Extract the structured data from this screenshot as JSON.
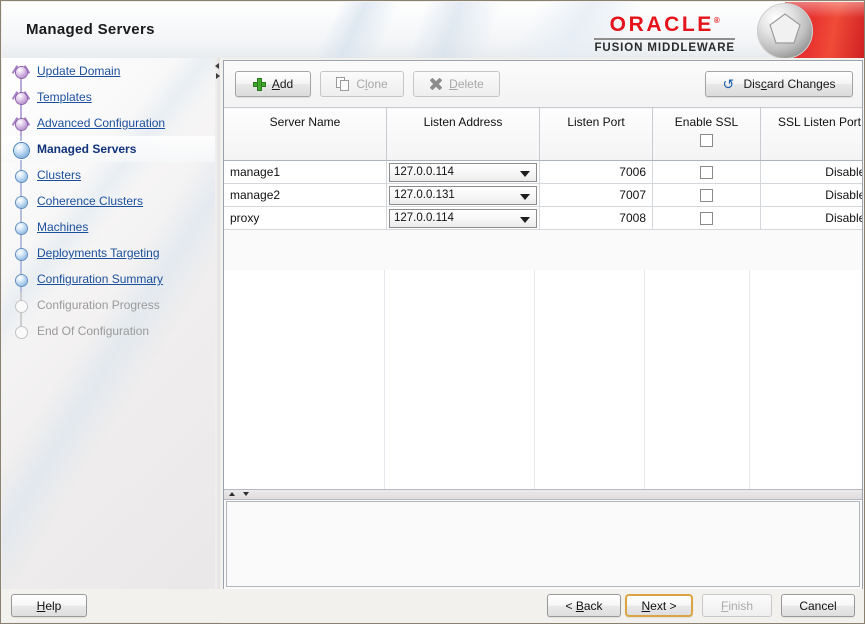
{
  "window": {
    "title": "Managed Servers"
  },
  "brand": {
    "wordmark": "ORACLE",
    "registered": "®",
    "product": "FUSION MIDDLEWARE",
    "logo_icon": "oracle-sphere-icon",
    "accent_red": "#e4141a",
    "link_blue": "#1b4f9c"
  },
  "sidebar": {
    "items": [
      {
        "label": "Update Domain",
        "icon": "branch-node-icon",
        "state": "link"
      },
      {
        "label": "Templates",
        "icon": "branch-node-icon",
        "state": "link"
      },
      {
        "label": "Advanced Configuration",
        "icon": "branch-node-icon",
        "state": "link"
      },
      {
        "label": "Managed Servers",
        "icon": "current-node-icon",
        "state": "current"
      },
      {
        "label": "Clusters",
        "icon": "node-icon",
        "state": "link"
      },
      {
        "label": "Coherence Clusters",
        "icon": "node-icon",
        "state": "link"
      },
      {
        "label": "Machines",
        "icon": "node-icon",
        "state": "link"
      },
      {
        "label": "Deployments Targeting",
        "icon": "node-icon",
        "state": "link"
      },
      {
        "label": "Configuration Summary",
        "icon": "node-icon",
        "state": "link"
      },
      {
        "label": "Configuration Progress",
        "icon": "empty-node-icon",
        "state": "disabled"
      },
      {
        "label": "End Of Configuration",
        "icon": "empty-node-icon",
        "state": "disabled"
      }
    ]
  },
  "toolbar": {
    "add": {
      "label": "Add",
      "mnemonic": "A",
      "icon": "plus-icon",
      "enabled": true
    },
    "clone": {
      "label": "Clone",
      "mnemonic": "l",
      "icon": "copy-icon",
      "enabled": false
    },
    "delete": {
      "label": "Delete",
      "mnemonic": "D",
      "icon": "x-icon",
      "enabled": false
    },
    "discard": {
      "label": "Discard Changes",
      "mnemonic": "c",
      "icon": "undo-icon",
      "enabled": true
    }
  },
  "table": {
    "columns": [
      "Server Name",
      "Listen Address",
      "Listen Port",
      "Enable SSL",
      "SSL Listen Port"
    ],
    "header_ssl_checkbox": false,
    "rows": [
      {
        "server_name": "manage1",
        "listen_address": "127.0.0.114",
        "listen_port": "7006",
        "enable_ssl": false,
        "ssl_listen_port": "Disabled"
      },
      {
        "server_name": "manage2",
        "listen_address": "127.0.0.131",
        "listen_port": "7007",
        "enable_ssl": false,
        "ssl_listen_port": "Disabled"
      },
      {
        "server_name": "proxy",
        "listen_address": "127.0.0.114",
        "listen_port": "7008",
        "enable_ssl": false,
        "ssl_listen_port": "Disabled"
      }
    ]
  },
  "footer": {
    "help": {
      "label": "Help",
      "mnemonic": "H",
      "enabled": true
    },
    "back": {
      "label": "< Back",
      "mnemonic": "B",
      "enabled": true
    },
    "next": {
      "label": "Next >",
      "mnemonic": "N",
      "enabled": true,
      "focused": true
    },
    "finish": {
      "label": "Finish",
      "mnemonic": "F",
      "enabled": false
    },
    "cancel": {
      "label": "Cancel",
      "mnemonic": "",
      "enabled": true
    }
  }
}
